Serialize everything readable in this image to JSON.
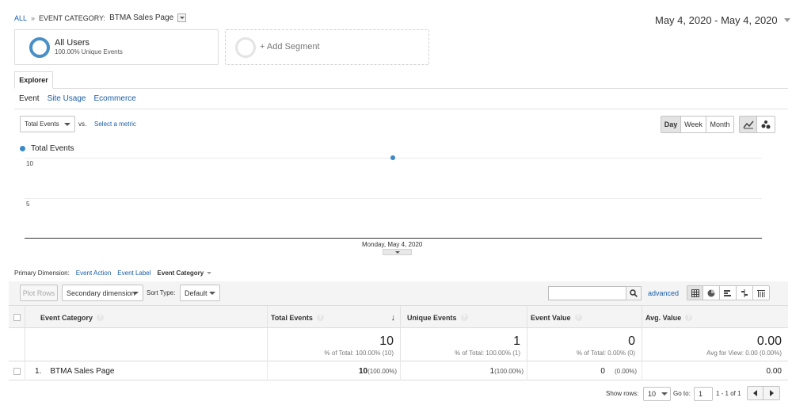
{
  "breadcrumb": {
    "all": "ALL",
    "separator": "»",
    "category_label": "EVENT CATEGORY:",
    "category_value": "BTMA Sales Page"
  },
  "date_range": "May 4, 2020 - May 4, 2020",
  "segments": {
    "all_users_title": "All Users",
    "all_users_sub": "100.00% Unique Events",
    "add_segment": "+ Add Segment"
  },
  "tabs": {
    "explorer": "Explorer"
  },
  "subtabs": [
    "Event",
    "Site Usage",
    "Ecommerce"
  ],
  "chart_controls": {
    "metric": "Total Events",
    "vs": "vs.",
    "select_metric": "Select a metric",
    "granularity": [
      "Day",
      "Week",
      "Month"
    ],
    "active_granularity": "Day"
  },
  "chart_data": {
    "type": "line",
    "series": [
      {
        "name": "Total Events",
        "values": [
          10
        ]
      }
    ],
    "x": [
      "Monday, May 4, 2020"
    ],
    "y_ticks": [
      "10",
      "5"
    ],
    "ylim": [
      0,
      10
    ],
    "colors": {
      "series": "#3b89c9"
    }
  },
  "dimension": {
    "label": "Primary Dimension:",
    "options": [
      "Event Action",
      "Event Label"
    ],
    "active": "Event Category"
  },
  "toolbar": {
    "plot_rows": "Plot Rows",
    "secondary_dimension": "Secondary dimension",
    "sort_type_label": "Sort Type:",
    "sort_type": "Default",
    "advanced": "advanced"
  },
  "table": {
    "headers": [
      "Event Category",
      "Total Events",
      "Unique Events",
      "Event Value",
      "Avg. Value"
    ],
    "totals": [
      {
        "value": "10",
        "sub": "% of Total: 100.00% (10)"
      },
      {
        "value": "1",
        "sub": "% of Total: 100.00% (1)"
      },
      {
        "value": "0",
        "sub": "% of Total: 0.00% (0)"
      },
      {
        "value": "0.00",
        "sub": "Avg for View: 0.00 (0.00%)"
      }
    ],
    "rows": [
      {
        "index": "1.",
        "category": "BTMA Sales Page",
        "total_events": "10",
        "total_events_pct": "(100.00%)",
        "unique_events": "1",
        "unique_events_pct": "(100.00%)",
        "event_value": "0",
        "event_value_pct": "(0.00%)",
        "avg_value": "0.00"
      }
    ]
  },
  "pagination": {
    "show_rows_label": "Show rows:",
    "show_rows": "10",
    "goto_label": "Go to:",
    "goto_value": "1",
    "range": "1 - 1 of 1"
  }
}
